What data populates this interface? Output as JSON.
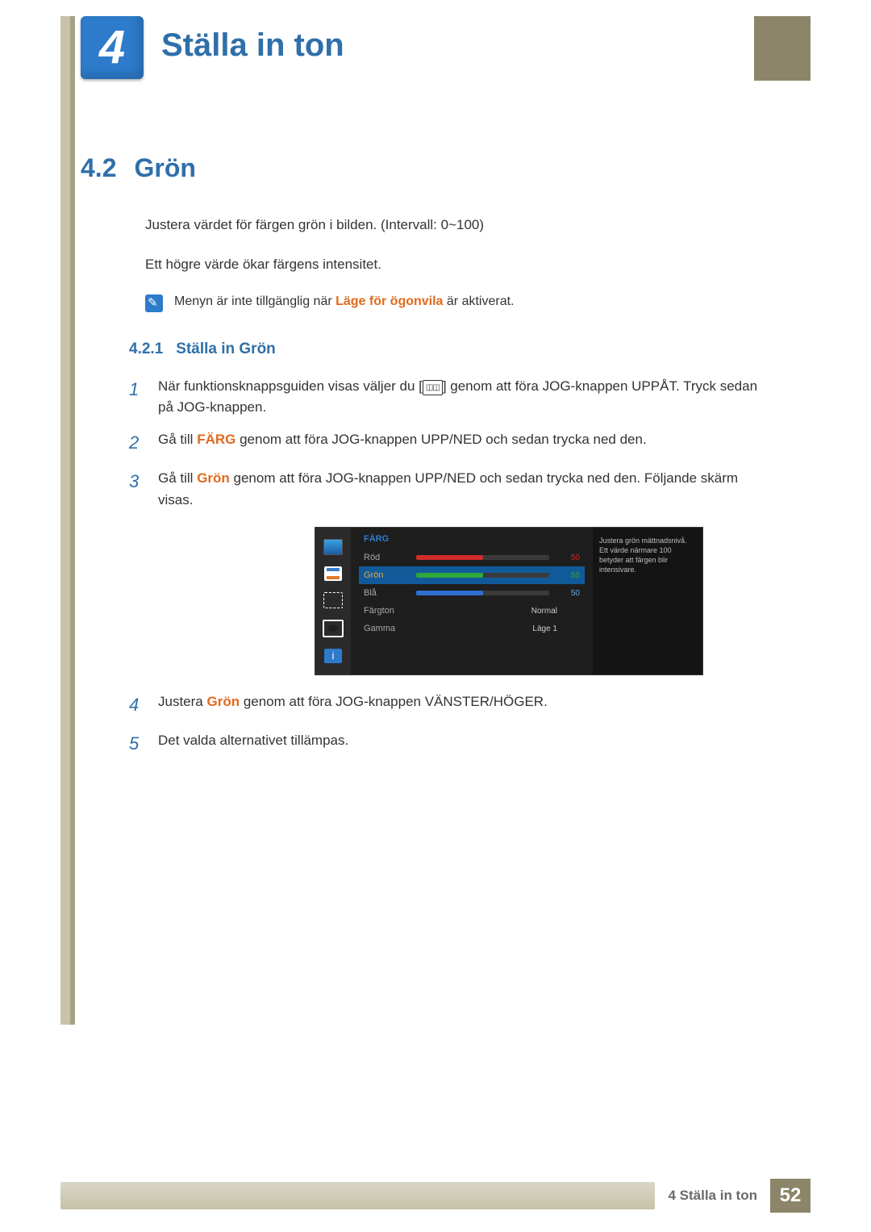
{
  "chapter": {
    "number": "4",
    "title": "Ställa in ton"
  },
  "section": {
    "number": "4.2",
    "title": "Grön"
  },
  "intro": {
    "p1": "Justera värdet för färgen grön i bilden. (Intervall: 0~100)",
    "p2": "Ett högre värde ökar färgens intensitet."
  },
  "note": {
    "pre": "Menyn är inte tillgänglig när ",
    "em": "Läge för ögonvila",
    "post": " är aktiverat."
  },
  "subsection": {
    "number": "4.2.1",
    "title": "Ställa in Grön"
  },
  "steps": {
    "s1": {
      "pre": "När funktionsknappsguiden visas väljer du [",
      "post": "] genom att föra JOG-knappen UPPÅT. Tryck sedan på JOG-knappen."
    },
    "s2": {
      "pre": "Gå till ",
      "em": "FÄRG",
      "post": " genom att föra JOG-knappen UPP/NED och sedan trycka ned den."
    },
    "s3": {
      "pre": "Gå till ",
      "em": "Grön",
      "post": " genom att föra JOG-knappen UPP/NED och sedan trycka ned den. Följande skärm visas."
    },
    "s4": {
      "pre": "Justera ",
      "em": "Grön",
      "post": " genom att föra JOG-knappen VÄNSTER/HÖGER."
    },
    "s5": {
      "text": "Det valda alternativet tillämpas."
    }
  },
  "osd": {
    "header": "FÄRG",
    "rows": {
      "red": {
        "label": "Röd",
        "value": "50",
        "fill": 50,
        "fill_color": "#cf2b2b",
        "val_color": "#cf2b2b"
      },
      "green": {
        "label": "Grön",
        "value": "50",
        "fill": 50,
        "fill_color": "#2fa83a",
        "val_color": "#2fa83a"
      },
      "blue": {
        "label": "Blå",
        "value": "50",
        "fill": 50,
        "fill_color": "#2d6fd0",
        "val_color": "#6aa6e6"
      },
      "tone": {
        "label": "Färgton",
        "value": "Normal"
      },
      "gamma": {
        "label": "Gamma",
        "value": "Läge 1"
      }
    },
    "help": "Justera grön mättnadsnivå. Ett värde närmare 100 betyder att färgen blir intensivare."
  },
  "footer": {
    "title": "4 Ställa in ton",
    "page": "52"
  }
}
